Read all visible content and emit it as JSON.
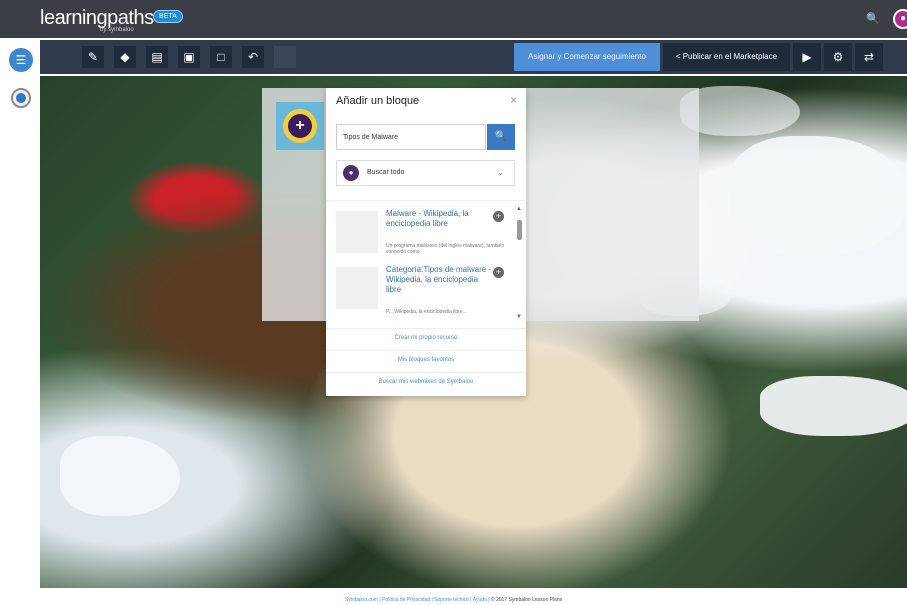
{
  "header": {
    "logo": "learningpaths",
    "logo_sub": "by symbaloo",
    "beta": "BETA",
    "search_icon": "search-icon"
  },
  "toolbar": {
    "assign_label": "Asignar y Comenzar seguimiento",
    "publish_label": "< Publicar en el Marketplace",
    "tools": [
      "pencil-icon",
      "tag-icon",
      "tree-icon",
      "image-icon",
      "layout-icon",
      "undo-icon"
    ]
  },
  "modal": {
    "title": "Añadir un bloque",
    "close": "×",
    "search_value": "Tipos de Malware",
    "select_label": "Buscar todo",
    "results": [
      {
        "title": "Malware - Wikipedia, la enciclopedia libre",
        "desc": "Un programa malicioso (del inglés malware), también conocido como"
      },
      {
        "title": "Categoría:Tipos de malware - Wikipedia, la enciclopedia libre",
        "desc": "P... Wikipedia, la enciclopedia libre..."
      }
    ],
    "footer_links": [
      "Crear mi propio recurso",
      "Mis bloques favoritos",
      "Buscar mis webmixes de Symbaloo"
    ]
  },
  "page_footer": {
    "links": "Symbaloo.com | Política de Privacidad | Soporte técnico | Ayuda |",
    "copyright": "© 2017 Symbaloo Lesson Plans"
  },
  "colors": {
    "topbar": "#3c3e46",
    "toolbar": "#2f3a4d",
    "accent": "#4f8fd8"
  }
}
